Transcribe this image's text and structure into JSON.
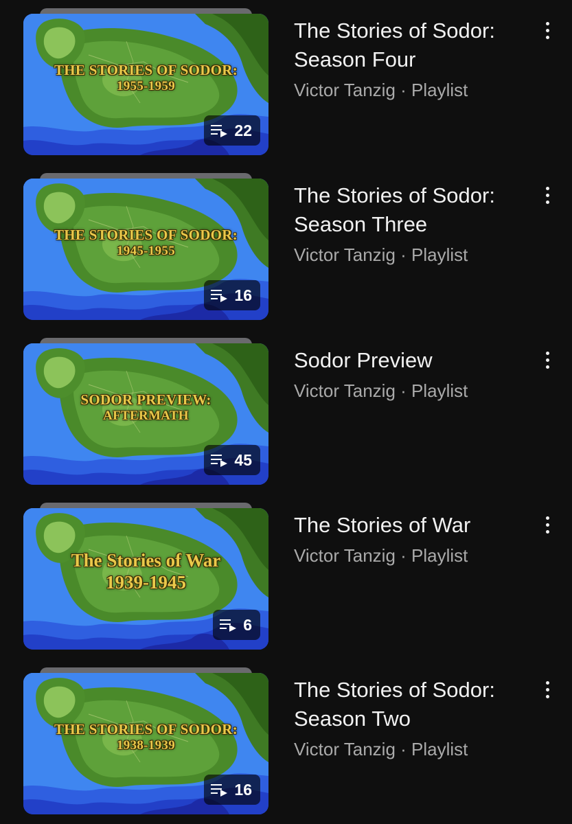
{
  "playlists": [
    {
      "thumb_line1": "THE STORIES OF SODOR:",
      "thumb_line2": "1955-1959",
      "count": "22",
      "title_line1": "The Stories of Sodor:",
      "title_line2": "Season Four",
      "subtitle": "Victor Tanzig · Playlist"
    },
    {
      "thumb_line1": "THE STORIES OF SODOR:",
      "thumb_line2": "1945-1955",
      "count": "16",
      "title_line1": "The Stories of Sodor:",
      "title_line2": "Season Three",
      "subtitle": "Victor Tanzig · Playlist"
    },
    {
      "thumb_line1": "SODOR PREVIEW:",
      "thumb_line2": "AFTERMATH",
      "count": "45",
      "title_line1": "Sodor Preview",
      "title_line2": "",
      "subtitle": "Victor Tanzig · Playlist"
    },
    {
      "thumb_line1": "The Stories of War",
      "thumb_line2": "1939-1945",
      "count": "6",
      "title_line1": "The Stories of War",
      "title_line2": "",
      "subtitle": "Victor Tanzig · Playlist"
    },
    {
      "thumb_line1": "THE STORIES OF SODOR:",
      "thumb_line2": "1938-1939",
      "count": "16",
      "title_line1": "The Stories of Sodor:",
      "title_line2": "Season Two",
      "subtitle": "Victor Tanzig · Playlist"
    }
  ],
  "icons": {
    "count_icon": "playlist-play-icon",
    "menu_icon": "more-vertical-icon"
  },
  "colors": {
    "background": "#0f0f0f",
    "title_text": "#f1f1f1",
    "subtitle_text": "#aaaaaa",
    "thumb_title": "#e9c94a"
  }
}
